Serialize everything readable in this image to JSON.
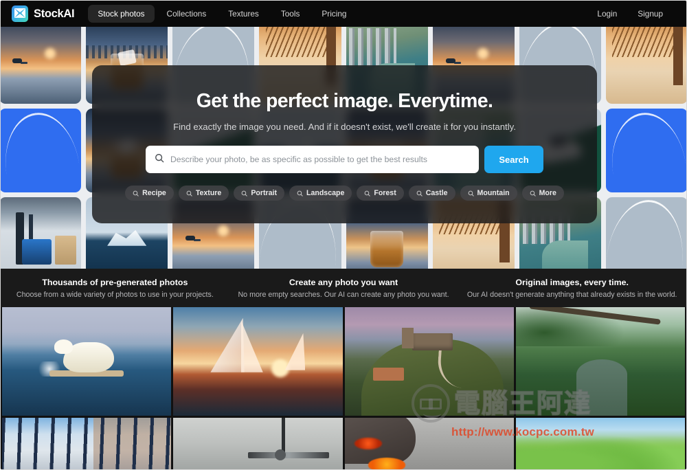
{
  "navbar": {
    "brand": "StockAI",
    "logo_icon": "stockai-logo-icon",
    "links": [
      {
        "label": "Stock photos",
        "active": true
      },
      {
        "label": "Collections",
        "active": false
      },
      {
        "label": "Textures",
        "active": false
      },
      {
        "label": "Tools",
        "active": false
      },
      {
        "label": "Pricing",
        "active": false
      }
    ],
    "right_links": [
      {
        "label": "Login"
      },
      {
        "label": "Signup"
      }
    ]
  },
  "hero": {
    "title": "Get the perfect image. Everytime.",
    "subtitle": "Find exactly the image you need. And if it doesn't exist, we'll create it for you instantly.",
    "search": {
      "placeholder": "Describe your photo, be as specific as possible to get the best results",
      "value": "",
      "icon": "search-icon",
      "button_label": "Search",
      "button_color": "#1fa7ee"
    },
    "chips": [
      {
        "label": "Recipe",
        "icon": "search-icon"
      },
      {
        "label": "Texture",
        "icon": "search-icon"
      },
      {
        "label": "Portrait",
        "icon": "search-icon"
      },
      {
        "label": "Landscape",
        "icon": "search-icon"
      },
      {
        "label": "Forest",
        "icon": "search-icon"
      },
      {
        "label": "Castle",
        "icon": "search-icon"
      },
      {
        "label": "Mountain",
        "icon": "search-icon"
      },
      {
        "label": "More",
        "icon": "search-icon"
      }
    ]
  },
  "features": [
    {
      "title": "Thousands of pre-generated photos",
      "text": "Choose from a wide variety of photos to use in your projects."
    },
    {
      "title": "Create any photo you want",
      "text": "No more empty searches. Our AI can create any photo you want."
    },
    {
      "title": "Original images, every time.",
      "text": "Our AI doesn't generate anything that already exists in the world."
    }
  ],
  "gallery": [
    {
      "name": "polar-bear-on-ice"
    },
    {
      "name": "sailboats-at-sunset"
    },
    {
      "name": "castle-on-hill"
    },
    {
      "name": "jungle-river"
    },
    {
      "name": "winter-forest"
    },
    {
      "name": "gray-machinery-scene"
    },
    {
      "name": "volcano-lava"
    },
    {
      "name": "green-trees"
    }
  ],
  "watermark": {
    "text": "電腦王阿達",
    "url": "http://www.kocpc.com.tw",
    "url_color": "#e2401e"
  }
}
